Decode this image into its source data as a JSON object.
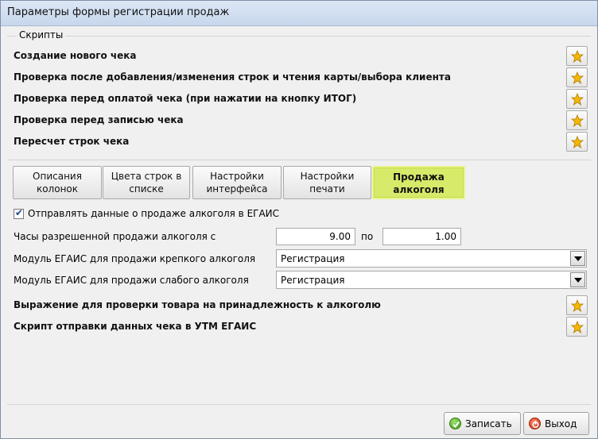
{
  "window": {
    "title": "Параметры формы регистрации продаж"
  },
  "scripts_section": {
    "legend": "Скрипты",
    "items": [
      {
        "label": "Создание нового чека"
      },
      {
        "label": "Проверка после добавления/изменения строк и чтения карты/выбора клиента"
      },
      {
        "label": "Проверка перед оплатой чека (при нажатии на кнопку ИТОГ)"
      },
      {
        "label": "Проверка перед записью чека"
      },
      {
        "label": "Пересчет строк чека"
      }
    ]
  },
  "tabs": [
    {
      "line1": "Описания",
      "line2": "колонок",
      "active": false
    },
    {
      "line1": "Цвета строк в",
      "line2": "списке",
      "active": false
    },
    {
      "line1": "Настройки",
      "line2": "интерфейса",
      "active": false
    },
    {
      "line1": "Настройки",
      "line2": "печати",
      "active": false
    },
    {
      "line1": "Продажа",
      "line2": "алкоголя",
      "active": true
    }
  ],
  "alcohol": {
    "send_egais_label": "Отправлять данные о продаже алкоголя в ЕГАИС",
    "send_egais_checked": true,
    "hours_label": "Часы разрешенной продажи алкоголя с",
    "hours_from": "9.00",
    "hours_to_label": "по",
    "hours_to": "1.00",
    "strong_module_label": "Модуль ЕГАИС для продажи крепкого алкоголя",
    "strong_module_value": "Регистрация",
    "weak_module_label": "Модуль ЕГАИС для продажи слабого алкоголя",
    "weak_module_value": "Регистрация",
    "expr_label": "Выражение для проверки товара на принадлежность к алкоголю",
    "utm_label": "Скрипт отправки данных чека в УТМ ЕГАИС"
  },
  "buttons": {
    "save": "Записать",
    "exit": "Выход"
  },
  "icons": {
    "script_button": "star-icon",
    "save": "check-circle-icon",
    "exit": "power-icon"
  },
  "colors": {
    "active_tab": "#d7ea6a",
    "star": "#f5b800"
  }
}
